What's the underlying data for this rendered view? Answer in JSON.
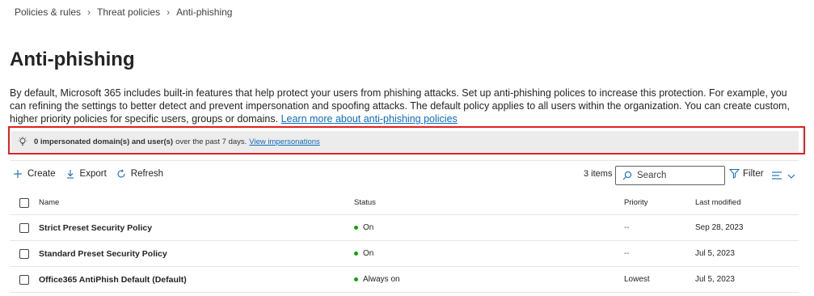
{
  "breadcrumb": {
    "items": [
      "Policies & rules",
      "Threat policies",
      "Anti-phishing"
    ]
  },
  "page": {
    "title": "Anti-phishing",
    "description": "By default, Microsoft 365 includes built-in features that help protect your users from phishing attacks. Set up anti-phishing polices to increase this protection. For example, you can refining the settings to better detect and prevent impersonation and spoofing attacks. The default policy applies to all users within the organization. You can create custom, higher priority policies for specific users, groups or domains.",
    "learn_more_link": "Learn more about anti-phishing policies"
  },
  "banner": {
    "icon": "lightbulb-icon",
    "bold_text": "0 impersonated domain(s) and user(s)",
    "text": "over the past 7 days.",
    "link": "View impersonations",
    "highlight_color": "#e02020"
  },
  "toolbar": {
    "create_label": "Create",
    "export_label": "Export",
    "refresh_label": "Refresh",
    "items_count": "3 items",
    "search_placeholder": "Search",
    "filter_label": "Filter"
  },
  "table": {
    "columns": {
      "name": "Name",
      "status": "Status",
      "priority": "Priority",
      "modified": "Last modified"
    },
    "rows": [
      {
        "name": "Strict Preset Security Policy",
        "status": "On",
        "priority": "--",
        "modified": "Sep 28, 2023"
      },
      {
        "name": "Standard Preset Security Policy",
        "status": "On",
        "priority": "--",
        "modified": "Jul 5, 2023"
      },
      {
        "name": "Office365 AntiPhish Default (Default)",
        "status": "Always on",
        "priority": "Lowest",
        "modified": "Jul 5, 2023"
      }
    ],
    "status_color": "#13a10e"
  }
}
